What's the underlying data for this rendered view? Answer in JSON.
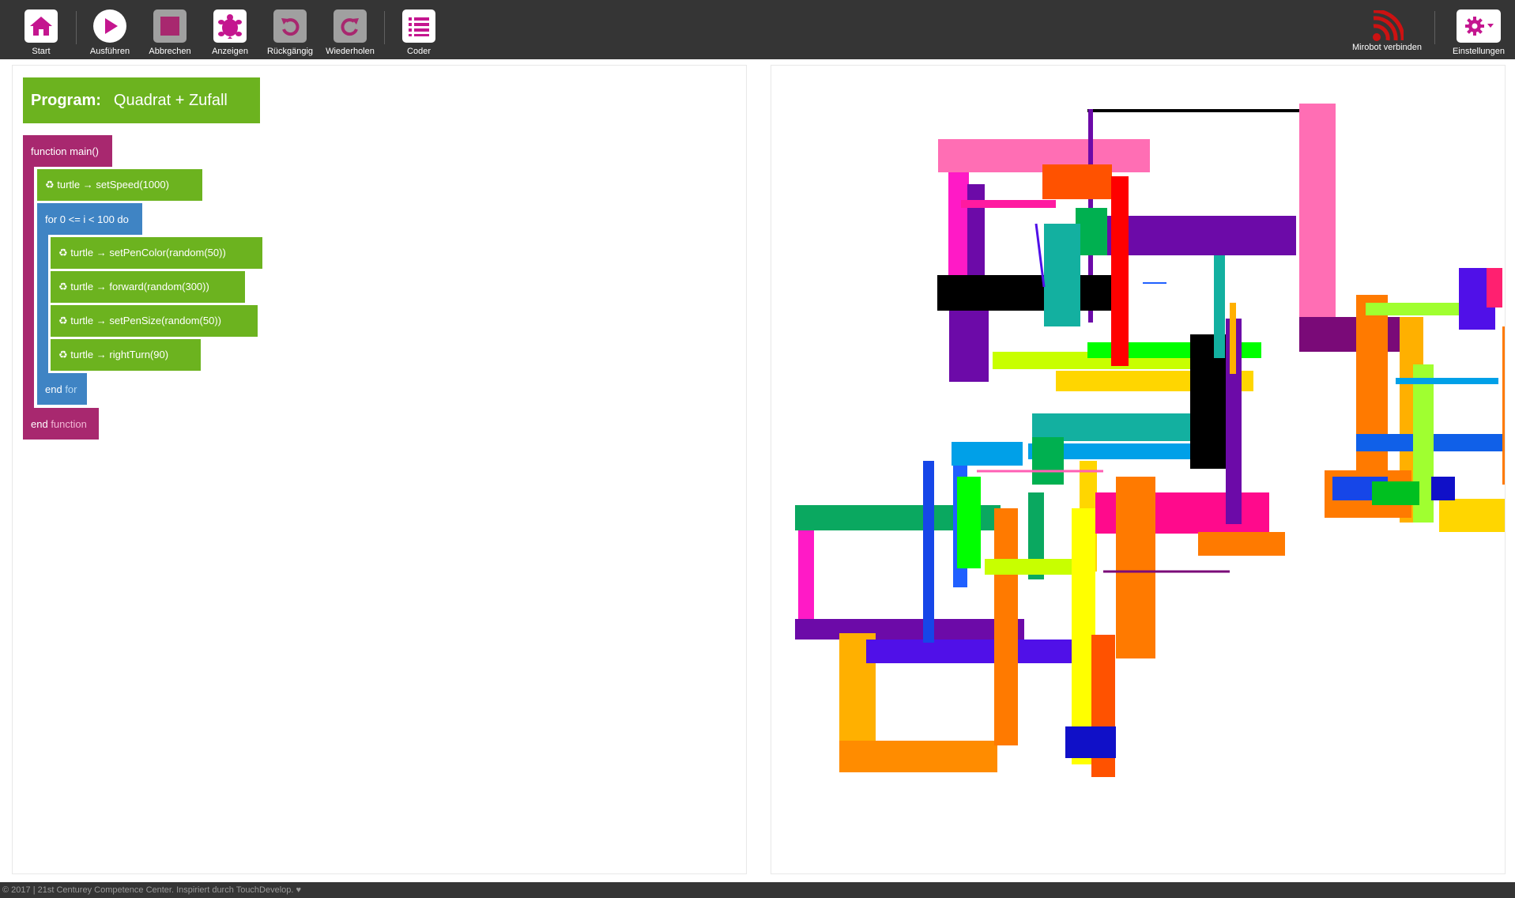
{
  "toolbar": {
    "start": "Start",
    "run": "Ausführen",
    "abort": "Abbrechen",
    "show": "Anzeigen",
    "undo": "Rückgängig",
    "redo": "Wiederholen",
    "coder": "Coder",
    "mirobot": "Mirobot verbinden",
    "settings": "Einstellungen"
  },
  "colors": {
    "accent": "#c4168f",
    "toolbar_bg": "#353535",
    "green_block": "#6cb31f",
    "blue_block": "#3f84c4",
    "magenta_block": "#a8286f",
    "wifi_red": "#cc1212"
  },
  "icons": {
    "start": "home-icon",
    "run": "play-icon",
    "abort": "stop-icon",
    "show": "turtle-icon",
    "undo": "undo-icon",
    "redo": "redo-icon",
    "coder": "list-icon",
    "mirobot": "wifi-icon",
    "settings": "gear-icon"
  },
  "program": {
    "label": "Program:",
    "name": "Quadrat + Zufall"
  },
  "code": {
    "main_fn": "function main()",
    "set_speed": "♻ turtle → setSpeed(1000)",
    "for_loop": "for 0 <= i < 100 do",
    "set_pen_color": "♻ turtle → setPenColor(random(50))",
    "forward": "♻ turtle → forward(random(300))",
    "set_pen_size": "♻ turtle → setPenSize(random(50))",
    "right_turn": "♻ turtle → rightTurn(90)",
    "end_for_kw": "end",
    "end_for_rest": " for",
    "end_fn_kw": "end",
    "end_fn_rest": " function"
  },
  "footer": {
    "text": "© 2017 | 21st Centurey Competence Center. Inspiriert durch TouchDevelop. ♥"
  }
}
